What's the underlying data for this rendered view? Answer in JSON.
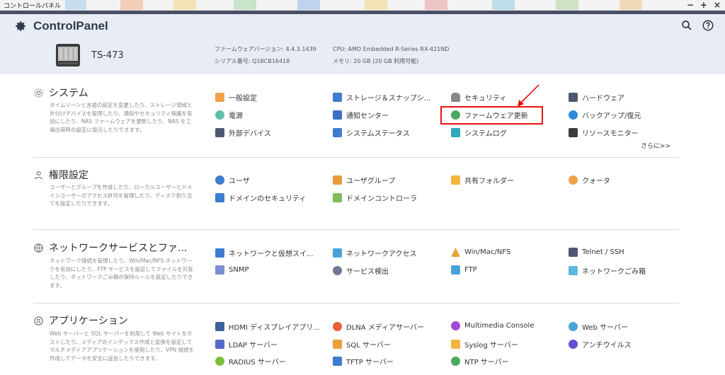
{
  "window": {
    "title": "コントロールパネル",
    "min": "−",
    "max": "+",
    "close": "×"
  },
  "header": {
    "app_title": "ControlPanel",
    "model": "TS-473",
    "firmware_label": "ファームウェアバージョン: 4.4.3.1439",
    "serial_label": "シリアル番号: Q18CB16418",
    "cpu_label": "CPU: AMD Embedded R-Series RX-421ND",
    "memory_label": "メモリ: 20 GB (20 GB 利用可能)"
  },
  "sections": [
    {
      "title": "システム",
      "desc": "タイムゾーンと言語の設定を変更したり、ストレージ領域と外付けデバイスを管理したり、通知やセキュリティ保護を有効にしたり、NAS ファームウェアを更新したり、NAS を工場出荷時の設定に復元したりできます。",
      "items": [
        "一般設定",
        "ストレージ＆スナップシ...",
        "セキュリティ",
        "ハードウェア",
        "電源",
        "通知センター",
        "ファームウェア更新",
        "バックアップ/復元",
        "外部デバイス",
        "システムステータス",
        "システムログ",
        "リソースモニター"
      ],
      "more": "さらに>>"
    },
    {
      "title": "権限設定",
      "desc": "ユーザーとグループを作成したり、ローカルユーザーとドメインユーザーのアクセス許可を管理したり、ディスク割り当てを設定したりできます。",
      "items": [
        "ユーザ",
        "ユーザグループ",
        "共有フォルダー",
        "クォータ",
        "ドメインのセキュリティ",
        "ドメインコントローラ"
      ]
    },
    {
      "title": "ネットワークサービスとファ...",
      "desc": "ネットワーク接続を管理したり、Win/Mac/NFS ネットワークを有効にしたり、FTP サービスを設定してファイルを共有したり、ネットワークごみ箱の保持ルールを設定したりできます。",
      "items": [
        "ネットワークと仮想スイ...",
        "ネットワークアクセス",
        "Win/Mac/NFS",
        "Telnet / SSH",
        "SNMP",
        "サービス検出",
        "FTP",
        "ネットワークごみ箱"
      ]
    },
    {
      "title": "アプリケーション",
      "desc": "Web サーバーと SQL サーバーを利用して Web サイトをホストしたり、メディアのインデックス作成と変換を設定してマルチメディアアプリケーションを使用したり、VPN 接続を作成してデータを安全に送信したりできます。",
      "items": [
        "HDMI ディスプレイアプリ...",
        "DLNA メディアサーバー",
        "Multimedia Console",
        "Web サーバー",
        "LDAP サーバー",
        "SQL サーバー",
        "Syslog サーバー",
        "アンチウイルス",
        "RADIUS サーバー",
        "TFTP サーバー",
        "NTP サーバー"
      ]
    }
  ],
  "colors": {
    "accent": "#e11111",
    "header_bg": "#e8edf5",
    "titlebar_dark": "#4a4f66"
  }
}
